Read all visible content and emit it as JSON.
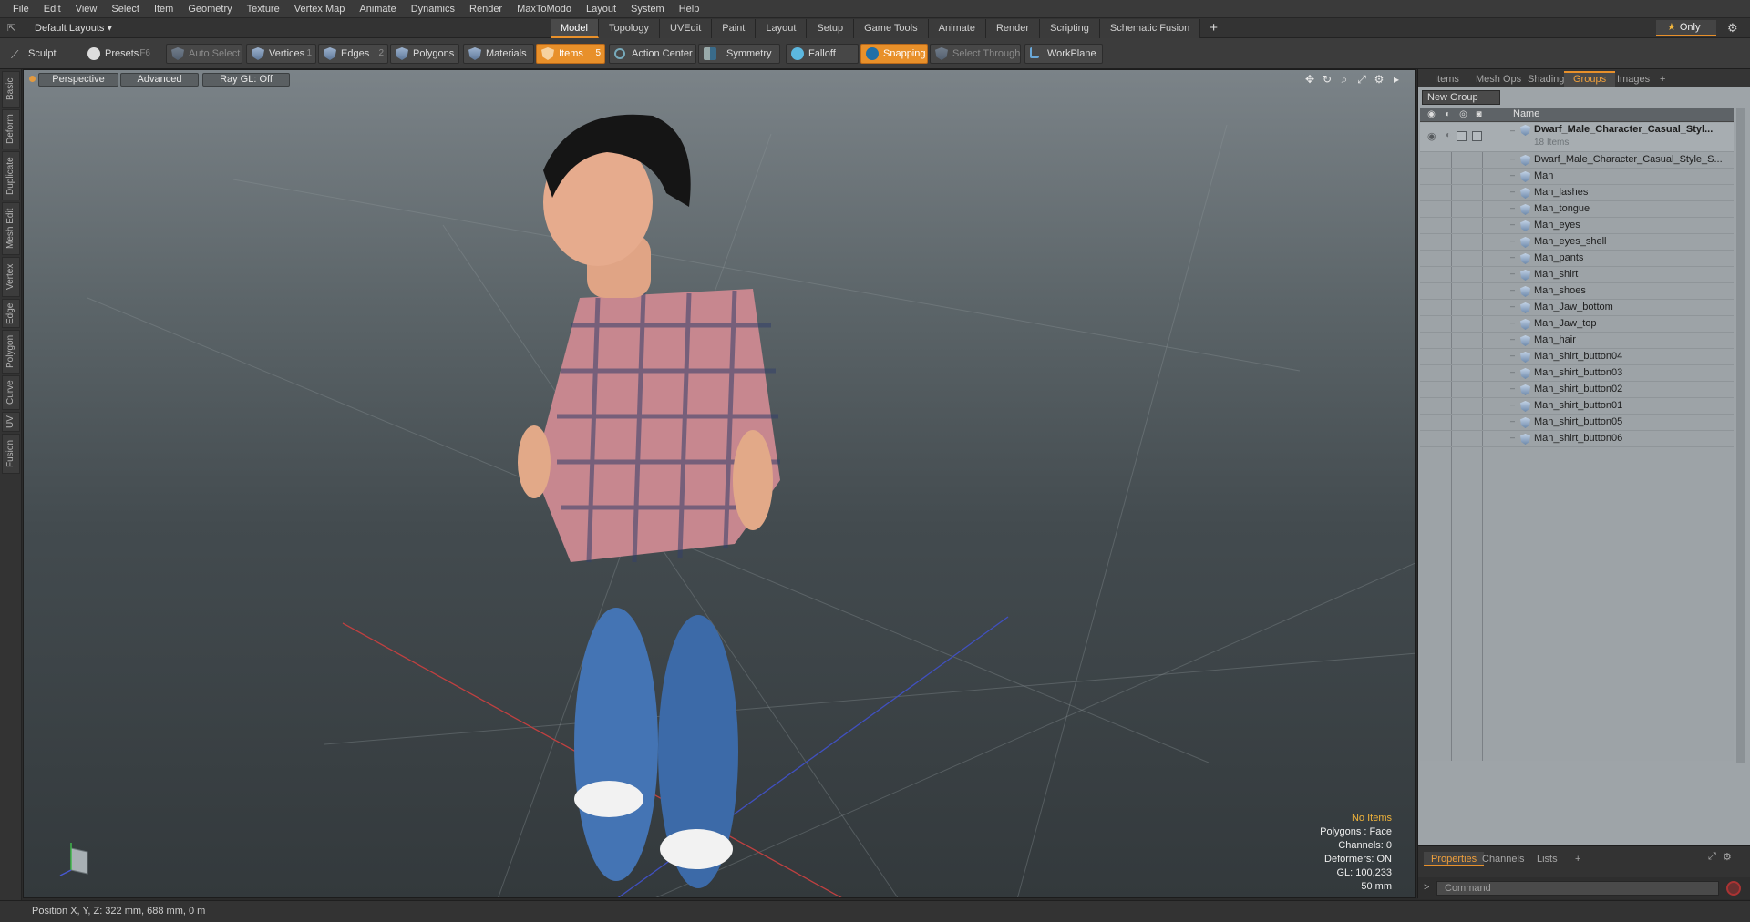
{
  "menu": [
    "File",
    "Edit",
    "View",
    "Select",
    "Item",
    "Geometry",
    "Texture",
    "Vertex Map",
    "Animate",
    "Dynamics",
    "Render",
    "MaxToModo",
    "Layout",
    "System",
    "Help"
  ],
  "layout_select": "Default Layouts ▾",
  "mode_tabs": [
    "Model",
    "Topology",
    "UVEdit",
    "Paint",
    "Layout",
    "Setup",
    "Game Tools",
    "Animate",
    "Render",
    "Scripting",
    "Schematic Fusion"
  ],
  "active_mode_tab": "Model",
  "only_label": "Only",
  "toolbar": {
    "sculpt": "Sculpt",
    "presets": "Presets",
    "presets_key": "F6",
    "auto_select": "Auto Select",
    "vertices": "Vertices",
    "vertices_key": "1",
    "edges": "Edges",
    "edges_key": "2",
    "polygons": "Polygons",
    "materials": "Materials",
    "items": "Items",
    "items_key": "5",
    "action_center": "Action Center",
    "symmetry": "Symmetry",
    "falloff": "Falloff",
    "snapping": "Snapping",
    "select_through": "Select Through",
    "workplane": "WorkPlane"
  },
  "left_tabs": [
    "Basic",
    "Deform",
    "Duplicate",
    "Mesh Edit",
    "Vertex",
    "Edge",
    "Polygon",
    "Curve",
    "UV",
    "Fusion"
  ],
  "viewport": {
    "view": "Perspective",
    "shading": "Advanced",
    "raygl": "Ray GL: Off",
    "stats": {
      "items": "No Items",
      "polygons": "Polygons : Face",
      "channels": "Channels: 0",
      "deformers": "Deformers: ON",
      "gl": "GL: 100,233",
      "focal": "50 mm"
    }
  },
  "right_panel": {
    "tabs": [
      "Items",
      "Mesh Ops",
      "Shading",
      "Groups",
      "Images"
    ],
    "active_tab": "Groups",
    "new_group": "New Group",
    "name_header": "Name",
    "root": {
      "label": "Dwarf_Male_Character_Casual_Styl...",
      "count": "18 Items"
    },
    "items": [
      "Dwarf_Male_Character_Casual_Style_S...",
      "Man",
      "Man_lashes",
      "Man_tongue",
      "Man_eyes",
      "Man_eyes_shell",
      "Man_pants",
      "Man_shirt",
      "Man_shoes",
      "Man_Jaw_bottom",
      "Man_Jaw_top",
      "Man_hair",
      "Man_shirt_button04",
      "Man_shirt_button03",
      "Man_shirt_button02",
      "Man_shirt_button01",
      "Man_shirt_button05",
      "Man_shirt_button06"
    ],
    "bottom_tabs": [
      "Properties",
      "Channels",
      "Lists"
    ],
    "active_bottom_tab": "Properties",
    "command_placeholder": "Command"
  },
  "status": "Position X, Y, Z:  322 mm, 688 mm, 0 m",
  "colors": {
    "accent": "#e8902a",
    "panel_bg": "#9ea4a8",
    "viewport_top": "#7b8388",
    "viewport_bottom": "#33393c"
  }
}
